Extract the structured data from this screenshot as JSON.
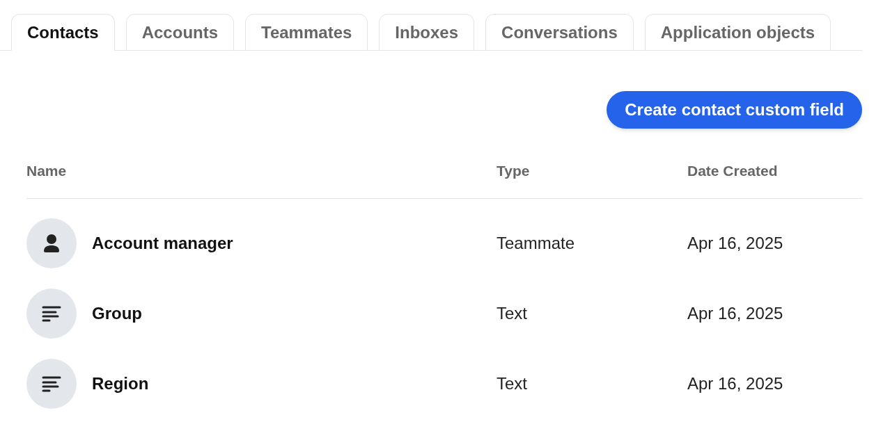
{
  "tabs": [
    {
      "label": "Contacts",
      "selected": true
    },
    {
      "label": "Accounts",
      "selected": false
    },
    {
      "label": "Teammates",
      "selected": false
    },
    {
      "label": "Inboxes",
      "selected": false
    },
    {
      "label": "Conversations",
      "selected": false
    },
    {
      "label": "Application objects",
      "selected": false
    }
  ],
  "create_button": "Create contact custom field",
  "table": {
    "columns": [
      "Name",
      "Type",
      "Date Created"
    ],
    "rows": [
      {
        "kind": "person",
        "name": "Account manager",
        "type": "Teammate",
        "date": "Apr 16, 2025"
      },
      {
        "kind": "text",
        "name": "Group",
        "type": "Text",
        "date": "Apr 16, 2025"
      },
      {
        "kind": "text",
        "name": "Region",
        "type": "Text",
        "date": "Apr 16, 2025"
      }
    ]
  }
}
